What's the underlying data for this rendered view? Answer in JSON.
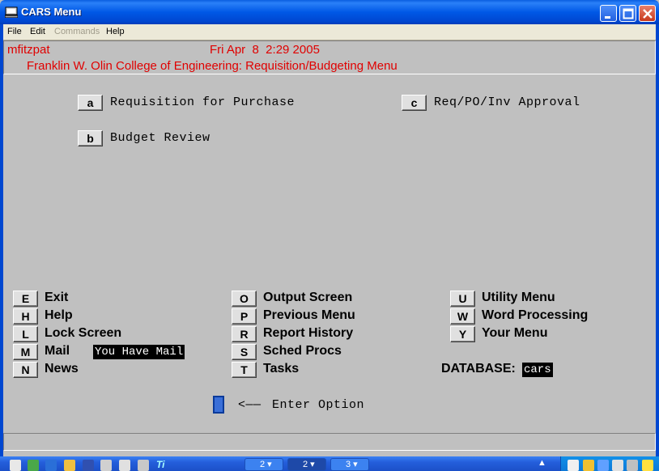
{
  "window": {
    "title": "CARS Menu"
  },
  "menubar": {
    "file": "File",
    "edit": "Edit",
    "commands": "Commands",
    "help": "Help"
  },
  "header": {
    "user": "mfitzpat",
    "datetime": "Fri Apr  8  2:29 2005",
    "subtitle": "Franklin W. Olin College of Engineering: Requisition/Budgeting Menu"
  },
  "main_options": [
    {
      "key": "a",
      "label": "Requisition for Purchase"
    },
    {
      "key": "b",
      "label": "Budget Review"
    },
    {
      "key": "c",
      "label": "Req/PO/Inv Approval"
    }
  ],
  "commands_col1": [
    {
      "key": "E",
      "label": "Exit"
    },
    {
      "key": "H",
      "label": "Help"
    },
    {
      "key": "L",
      "label": "Lock Screen"
    },
    {
      "key": "M",
      "label": "Mail"
    },
    {
      "key": "N",
      "label": "News"
    }
  ],
  "mail_notice": "You Have Mail",
  "commands_col2": [
    {
      "key": "O",
      "label": "Output Screen"
    },
    {
      "key": "P",
      "label": "Previous Menu"
    },
    {
      "key": "R",
      "label": "Report History"
    },
    {
      "key": "S",
      "label": "Sched Procs"
    },
    {
      "key": "T",
      "label": "Tasks"
    }
  ],
  "commands_col3": [
    {
      "key": "U",
      "label": "Utility Menu"
    },
    {
      "key": "W",
      "label": "Word Processing"
    },
    {
      "key": "Y",
      "label": "Your Menu"
    }
  ],
  "database": {
    "label": "DATABASE:",
    "value": "cars"
  },
  "prompt": {
    "arrow": "<——",
    "text": "Enter Option"
  },
  "taskbar": {
    "groups": [
      {
        "count": "2"
      },
      {
        "count": "2"
      },
      {
        "count": "3"
      }
    ],
    "ql_text": "Ti"
  },
  "colors": {
    "header_text": "#e00000",
    "titlebar": "#0058e6",
    "background": "#c0c0c0"
  }
}
